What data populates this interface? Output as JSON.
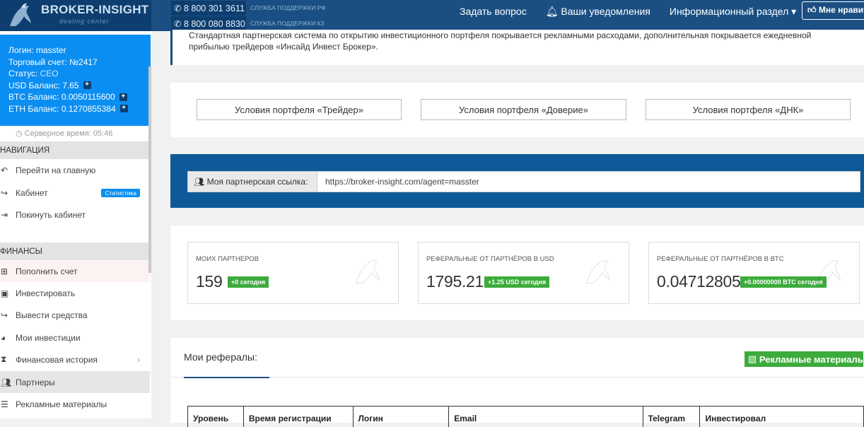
{
  "header": {
    "logo_text": "BROKER-INSIGHT",
    "logo_sub": "dealing center",
    "phones": [
      {
        "number": "8 800 301 3611",
        "label": "СЛУЖБА ПОДДЕРЖКИ РФ"
      },
      {
        "number": "8 800 080 8830",
        "label": "СЛУЖБА ПОДДЕРЖКИ КЗ"
      }
    ],
    "ask_question": "Задать вопрос",
    "notifications": "Ваши уведомления",
    "info_section": "Информационный раздел",
    "like_button": "Мне нравится"
  },
  "user": {
    "login_label": "Логин:",
    "login": "masster",
    "account_label": "Торговый счет:",
    "account": "№2417",
    "status_label": "Статус:",
    "status": "CEO",
    "usd_label": "USD Баланс:",
    "usd": "7.65",
    "btc_label": "BTC Баланс:",
    "btc": "0.0050115600",
    "eth_label": "ETH Баланс:",
    "eth": "0.1270855384",
    "server_time": "Серверное время: 05:46"
  },
  "sidebar": {
    "nav_title": "НАВИГАЦИЯ",
    "nav_items": [
      {
        "label": "Перейти на главную",
        "icon": "reply-icon"
      },
      {
        "label": "Кабинет",
        "icon": "share-icon",
        "badge": "Статистика"
      },
      {
        "label": "Покинуть кабинет",
        "icon": "sign-out-icon"
      }
    ],
    "finance_title": "ФИНАНСЫ",
    "finance_items": [
      {
        "label": "Пополнить счет",
        "icon": "plus-square-icon"
      },
      {
        "label": "Инвестировать",
        "icon": "briefcase-icon"
      },
      {
        "label": "Вывести средства",
        "icon": "share-icon"
      },
      {
        "label": "Мои инвестиции",
        "icon": "pie-chart-icon"
      },
      {
        "label": "Финансовая история",
        "icon": "hourglass-icon"
      },
      {
        "label": "Партнеры",
        "icon": "users-icon"
      },
      {
        "label": "Рекламные материалы",
        "icon": "list-icon"
      }
    ]
  },
  "main": {
    "info_text_1": "Стандартная партнерская система по открытию инвестиционного портфеля покрывается рекламными расходами, дополнительная покрывается ежедневной",
    "info_text_2": "прибылью трейдеров «Инсайд Инвест Брокер».",
    "portfolio_buttons": [
      "Условия портфеля «Трейдер»",
      "Условия портфеля «Доверие»",
      "Условия портфеля «ДНК»"
    ],
    "ref_link_label": "Моя партнерская ссылка:",
    "ref_link_value": "https://broker-insight.com/agent=masster",
    "stats": [
      {
        "title": "МОИХ ПАРТНЕРОВ",
        "value": "159",
        "badge": "+0 сегодня"
      },
      {
        "title": "РЕФЕРАЛЬНЫЕ ОТ ПАРТНЁРОВ В USD",
        "value": "1795.21",
        "badge": "+1.25 USD сегодня"
      },
      {
        "title": "РЕФЕРАЛЬНЫЕ ОТ ПАРТНЁРОВ В BTC",
        "value": "0.04712805",
        "badge": "+0.00000000 BTC сегодня"
      }
    ],
    "referrals_title": "Мои рефералы:",
    "ad_materials_button": "Рекламные материалы",
    "table_headers": [
      "Уровень",
      "Время регистрации",
      "Логин",
      "Email",
      "Telegram",
      "Инвестировал"
    ]
  }
}
